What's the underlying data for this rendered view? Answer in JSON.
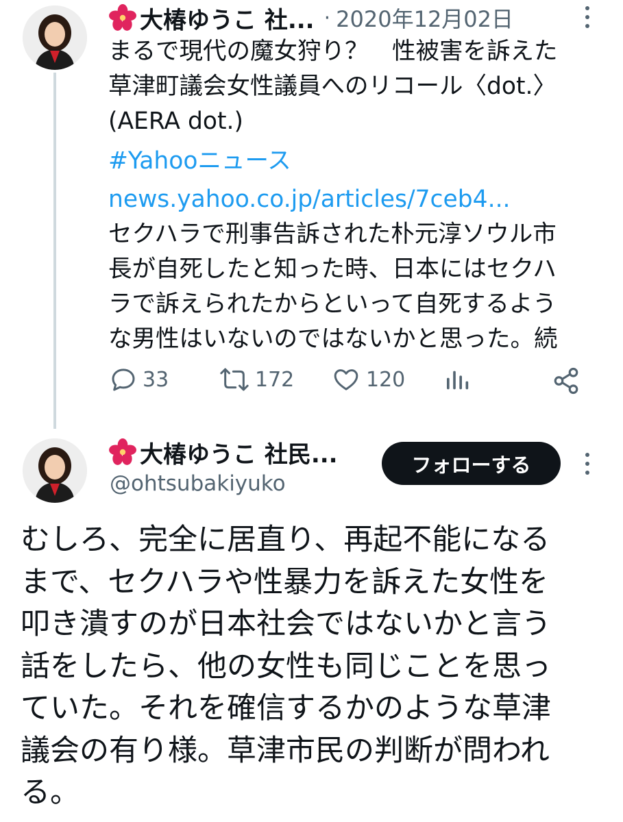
{
  "tweet1": {
    "author_name": "大椿ゆうこ 社...",
    "separator": "·",
    "date": "2020年12月02日",
    "text_lines": [
      "まるで現代の魔女狩り？　性被害を訴えた",
      "草津町議会女性議員へのリコール〈dot.〉",
      "(AERA dot.)"
    ],
    "hashtag": "#Yahooニュース",
    "link": "news.yahoo.co.jp/articles/7ceb4...",
    "body_lines": [
      "セクハラで刑事告訴された朴元淳ソウル市",
      "長が自死したと知った時、日本にはセクハ",
      "ラで訴えられたからといって自死するよう",
      "な男性はいないのではないかと思った。続"
    ],
    "replies": "33",
    "retweets": "172",
    "likes": "120",
    "icons": [
      "flower-icon",
      "more-icon",
      "reply-icon",
      "retweet-icon",
      "like-icon",
      "views-icon",
      "share-icon"
    ]
  },
  "tweet2": {
    "author_name": "大椿ゆうこ 社民...",
    "handle": "@ohtsubakiyuko",
    "follow_label": "フォローする",
    "text_lines": [
      "むしろ、完全に居直り、再起不能になる",
      "まで、セクハラや性暴力を訴えた女性を",
      "叩き潰すのが日本社会ではないかと言う",
      "話をしたら、他の女性も同じことを思っ",
      "ていた。それを確信するかのような草津",
      "議会の有り様。草津市民の判断が問われ",
      "る。"
    ]
  },
  "colors": {
    "link": "#1d9bf0",
    "secondary": "#536471",
    "follow_bg": "#0f1419",
    "flower": "#e0245e"
  }
}
